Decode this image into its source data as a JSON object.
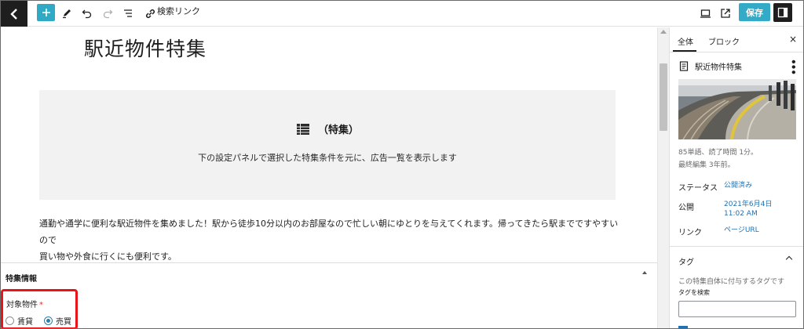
{
  "toolbar": {
    "link_label": "検索リンク",
    "save_label": "保存"
  },
  "editor": {
    "post_title": "駅近物件特集",
    "feature_block": {
      "heading": "（特集）",
      "description": "下の設定パネルで選択した特集条件を元に、広告一覧を表示します"
    },
    "paragraph_line1": "通勤や通学に便利な駅近物件を集めました！駅から徒歩10分以内のお部屋なので忙しい朝にゆとりを与えてくれます。帰ってきたら駅までですやすいので",
    "paragraph_line2": "買い物や外食に行くにも便利です。"
  },
  "metabox": {
    "title": "特集情報",
    "field_label": "対象物件",
    "required_mark": "*",
    "options": [
      {
        "label": "賃貸",
        "checked": false
      },
      {
        "label": "売買",
        "checked": true
      }
    ]
  },
  "sidebar": {
    "tabs": [
      "全体",
      "ブロック"
    ],
    "close_glyph": "×",
    "document_title": "駅近物件特集",
    "word_count": "85単語、読了時間 1分。",
    "last_edited": "最終編集 3年前。",
    "rows": [
      {
        "label": "ステータス",
        "value": "公開済み"
      },
      {
        "label": "公開",
        "value": "2021年6月4日",
        "value2": "11:02 AM"
      },
      {
        "label": "リンク",
        "value": "ページURL"
      }
    ],
    "tags": {
      "title": "タグ",
      "help": "この特集自体に付与するタグです",
      "search_label": "タグを検索"
    }
  },
  "colors": {
    "accent": "#33aac6",
    "link": "#2271b1",
    "highlight": "#e8141a",
    "dark": "#1e1e1e"
  }
}
